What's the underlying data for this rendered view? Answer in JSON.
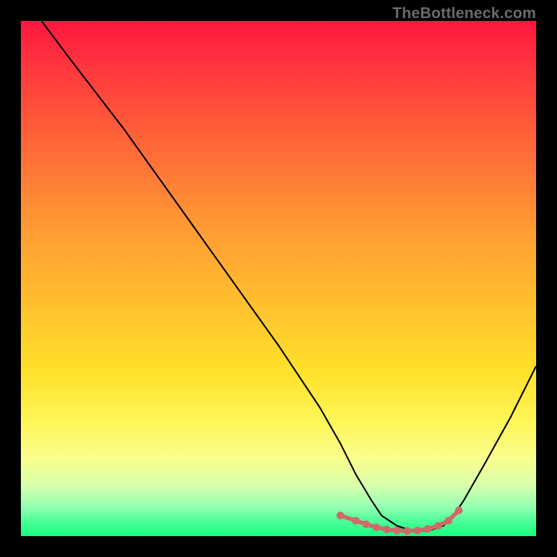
{
  "watermark": "TheBottleneck.com",
  "chart_data": {
    "type": "line",
    "title": "",
    "xlabel": "",
    "ylabel": "",
    "xlim": [
      0,
      100
    ],
    "ylim": [
      0,
      100
    ],
    "grid": false,
    "legend": false,
    "series": [
      {
        "name": "bottleneck-curve",
        "color": "#000000",
        "x": [
          4,
          10,
          20,
          30,
          40,
          50,
          58,
          62,
          65,
          68,
          70,
          73,
          76,
          79,
          82,
          84,
          86,
          90,
          95,
          100
        ],
        "y": [
          100,
          92,
          79,
          65,
          51,
          37,
          25,
          18,
          12,
          7,
          4,
          2,
          1,
          1,
          2,
          4,
          7,
          14,
          23,
          33
        ]
      }
    ],
    "markers": [
      {
        "name": "optimal-range-dots",
        "color": "#cf6a6a",
        "x": [
          62,
          65,
          67,
          69,
          71,
          73,
          75,
          77,
          79,
          81,
          83,
          85
        ],
        "y": [
          4,
          3,
          2.3,
          1.7,
          1.3,
          1.1,
          1,
          1.1,
          1.4,
          2,
          3,
          5
        ]
      }
    ]
  }
}
